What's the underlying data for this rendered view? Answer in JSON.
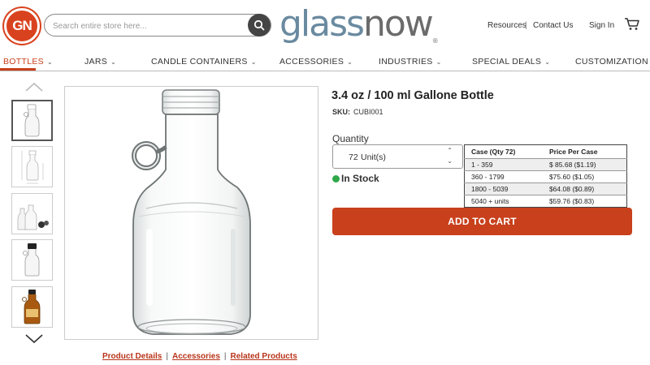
{
  "header": {
    "logo_text": "GN",
    "search_placeholder": "Search entire store here...",
    "brand_part1": "glass",
    "brand_part2": "now",
    "brand_mark": "®",
    "links": [
      "Resources",
      "|",
      "Contact Us",
      "Sign In"
    ]
  },
  "nav": {
    "items": [
      "BOTTLES",
      "JARS",
      "CANDLE CONTAINERS",
      "ACCESSORIES",
      "INDUSTRIES",
      "SPECIAL DEALS",
      "CUSTOMIZATION"
    ],
    "active_index": 0,
    "accent_color": "#c8401c"
  },
  "product": {
    "title": "3.4 oz / 100 ml Gallone Bottle",
    "sku_label": "SKU:",
    "sku_value": "CUBI001",
    "quantity_label": "Quantity",
    "quantity_value": "72",
    "quantity_unit": "Unit(s)",
    "stock_status": "In Stock",
    "stock_color": "#2ea84a",
    "add_to_cart": "ADD TO CART",
    "price_table": {
      "headers": [
        "Case (Qty 72)",
        "Price Per Case"
      ],
      "rows": [
        [
          "1 - 359",
          "$ 85.68 ($1.19)"
        ],
        [
          "360 - 1799",
          "$75.60 ($1.05)"
        ],
        [
          "1800 - 5039",
          "$64.08 ($0.89)"
        ],
        [
          "5040 + units",
          "$59.76 ($0.83)"
        ]
      ]
    }
  },
  "links": {
    "details": "Product Details",
    "sep": "|",
    "accessories": "Accessories",
    "related": "Related Products"
  },
  "icons": {
    "search": "search-icon",
    "cart": "cart-icon",
    "up": "chevron-up-icon",
    "down": "chevron-down-icon"
  }
}
